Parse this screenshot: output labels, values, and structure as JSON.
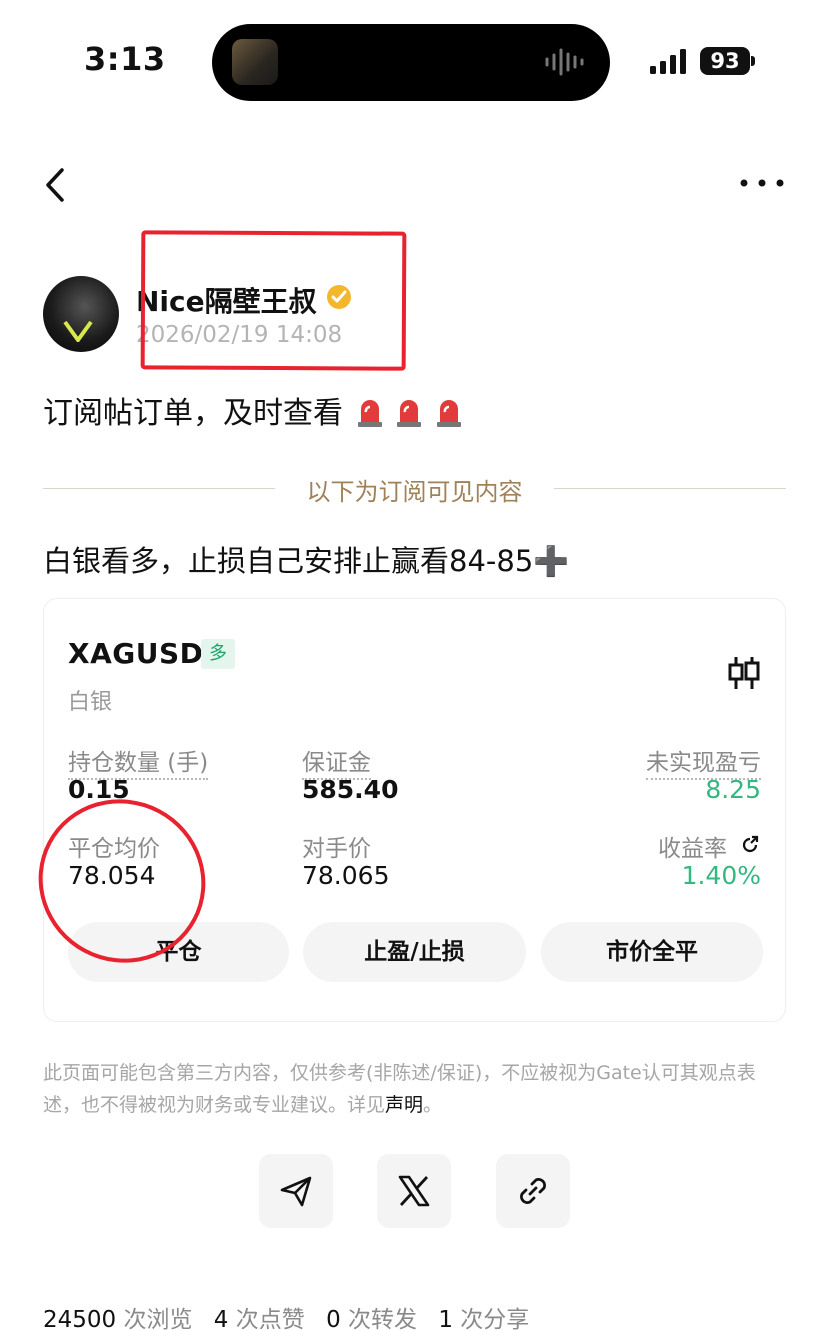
{
  "status_bar": {
    "time": "3:13",
    "battery": "93"
  },
  "author": {
    "name": "Nice隔壁王叔",
    "timestamp": "2026/02/19 14:08"
  },
  "post": {
    "text": "订阅帖订单，及时查看",
    "divider_label": "以下为订阅可见内容",
    "subscriber_text": "白银看多，止损自己安排止赢看84-85",
    "plus_glyph": "➕"
  },
  "position_card": {
    "symbol": "XAGUSD",
    "side_badge": "多",
    "symbol_cn": "白银",
    "fields": {
      "qty_label": "持仓数量 (手)",
      "qty_value": "0.15",
      "margin_label": "保证金",
      "margin_value": "585.40",
      "pnl_label": "未实现盈亏",
      "pnl_value": "8.25",
      "avg_label": "平仓均价",
      "avg_value": "78.054",
      "counter_label": "对手价",
      "counter_value": "78.065",
      "roi_label": "收益率",
      "roi_value": "1.40%"
    },
    "buttons": {
      "close": "平仓",
      "tp_sl": "止盈/止损",
      "close_all": "市价全平"
    },
    "colors": {
      "profit": "#34b882",
      "badge_bg": "#e3f5ec"
    }
  },
  "disclaimer": {
    "text": "此页面可能包含第三方内容，仅供参考(非陈述/保证)，不应被视为Gate认可其观点表述，也不得被视为财务或专业建议。详见",
    "link": "声明",
    "end": "。"
  },
  "share": {
    "icons": [
      "send-icon",
      "x-logo-icon",
      "link-icon"
    ]
  },
  "stats": {
    "views": "24500",
    "views_unit": "次浏览",
    "likes": "4",
    "likes_unit": "次点赞",
    "reposts": "0",
    "reposts_unit": "次转发",
    "shares": "1",
    "shares_unit": "次分享"
  },
  "annotations": {
    "highlight_color": "#e8222e"
  }
}
